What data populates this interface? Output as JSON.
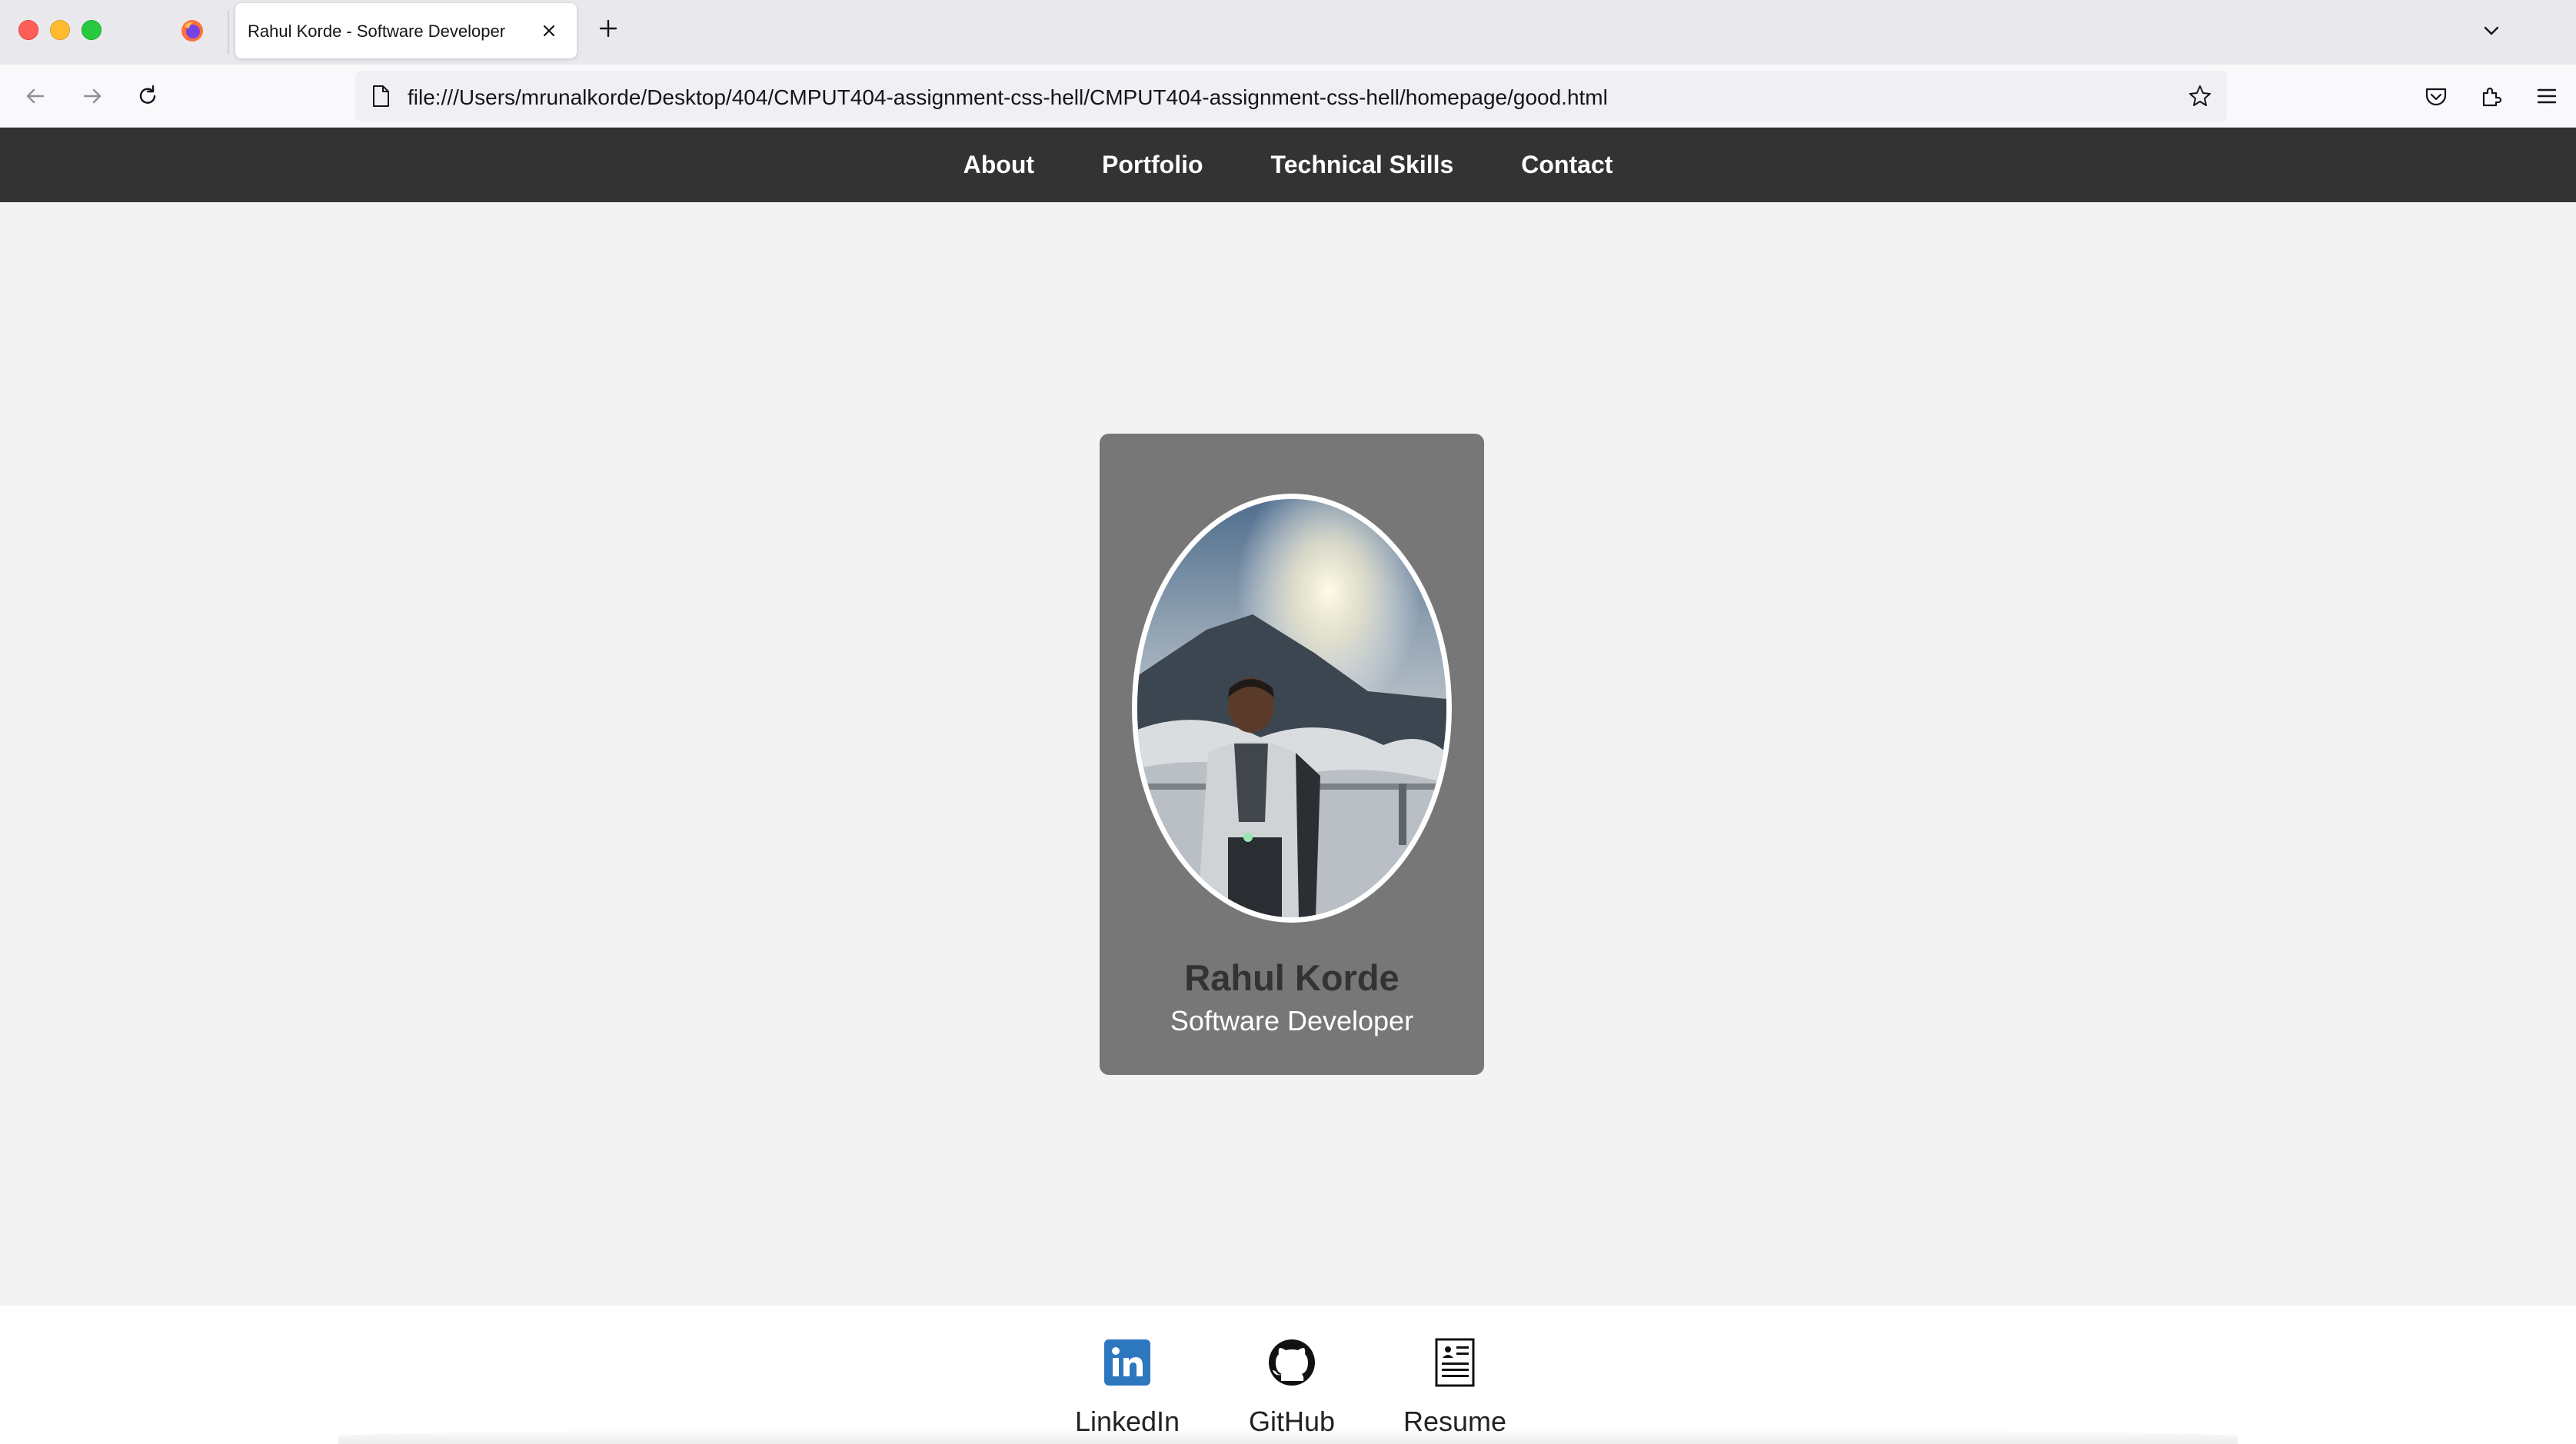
{
  "browser": {
    "tab_title": "Rahul Korde - Software Developer",
    "url": "file:///Users/mrunalkorde/Desktop/404/CMPUT404-assignment-css-hell/CMPUT404-assignment-css-hell/homepage/good.html"
  },
  "site_nav": {
    "items": [
      {
        "label": "About"
      },
      {
        "label": "Portfolio"
      },
      {
        "label": "Technical Skills"
      },
      {
        "label": "Contact"
      }
    ]
  },
  "profile": {
    "name": "Rahul Korde",
    "role": "Software Developer"
  },
  "footer": {
    "links": [
      {
        "label": "LinkedIn",
        "icon": "linkedin-icon"
      },
      {
        "label": "GitHub",
        "icon": "github-icon"
      },
      {
        "label": "Resume",
        "icon": "resume-icon"
      }
    ]
  },
  "colors": {
    "nav_bg": "#333333",
    "card_bg": "#777777",
    "page_bg": "#f3f3f3",
    "linkedin_blue": "#2d77bf"
  }
}
